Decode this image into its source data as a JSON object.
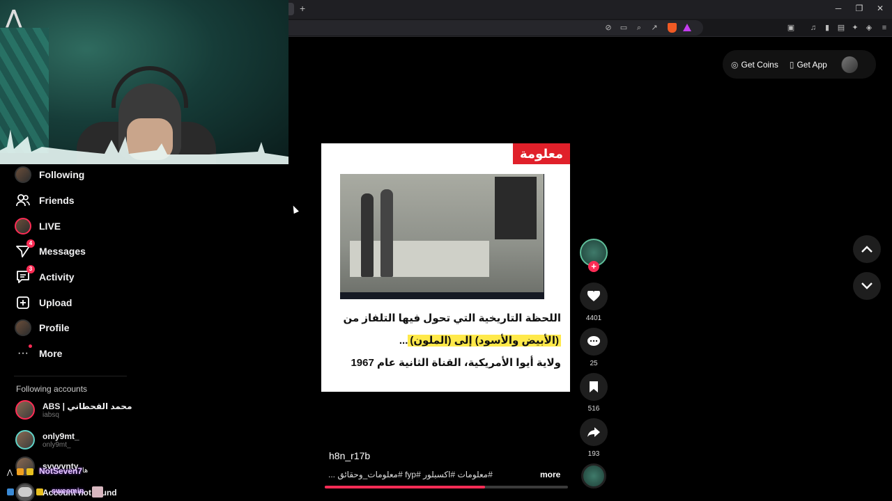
{
  "browser": {
    "new_tab": "+",
    "window": {
      "minimize": "─",
      "restore": "❐",
      "close": "✕"
    }
  },
  "header": {
    "get_coins": "Get Coins",
    "get_app": "Get App"
  },
  "sidebar": {
    "items": [
      {
        "label": "Following",
        "badge": ""
      },
      {
        "label": "Friends",
        "badge": ""
      },
      {
        "label": "LIVE",
        "badge": ""
      },
      {
        "label": "Messages",
        "badge": "4"
      },
      {
        "label": "Activity",
        "badge": "3"
      },
      {
        "label": "Upload",
        "badge": ""
      },
      {
        "label": "Profile",
        "badge": ""
      },
      {
        "label": "More",
        "badge": ""
      }
    ],
    "following_title": "Following accounts",
    "accounts": [
      {
        "name": "ABS | محمد القحطاني",
        "username": "iabsq"
      },
      {
        "name": "only9mt_",
        "username": "only9mt_"
      },
      {
        "name": "svvvvnty",
        "username": ""
      },
      {
        "name": "Account not found",
        "username": ""
      }
    ]
  },
  "stream_overlay": {
    "chat_user": "NotSeven7",
    "chat_message": "ها",
    "chat_user2": "sweemin"
  },
  "video": {
    "tag": "معلومة",
    "line1": "اللحظة التاريخية التي تحول فيها التلفاز من",
    "line2": "(الأبيض والأسود) إلى (الملون)",
    "line2_suffix": "...",
    "line3": "ولاية أيوا الأمريكية، القناة الثانية عام 1967",
    "progress": 0.66
  },
  "actions": {
    "likes": "4401",
    "comments": "25",
    "saves": "516",
    "shares": "193"
  },
  "post": {
    "author": "h8n_r17b",
    "caption": "#معلومات #اكسبلور #fyp #معلومات_وحقائق ...",
    "more": "more"
  },
  "colors": {
    "accent": "#fe2c55",
    "highlight": "#ffe94a",
    "tag": "#e0202a"
  }
}
